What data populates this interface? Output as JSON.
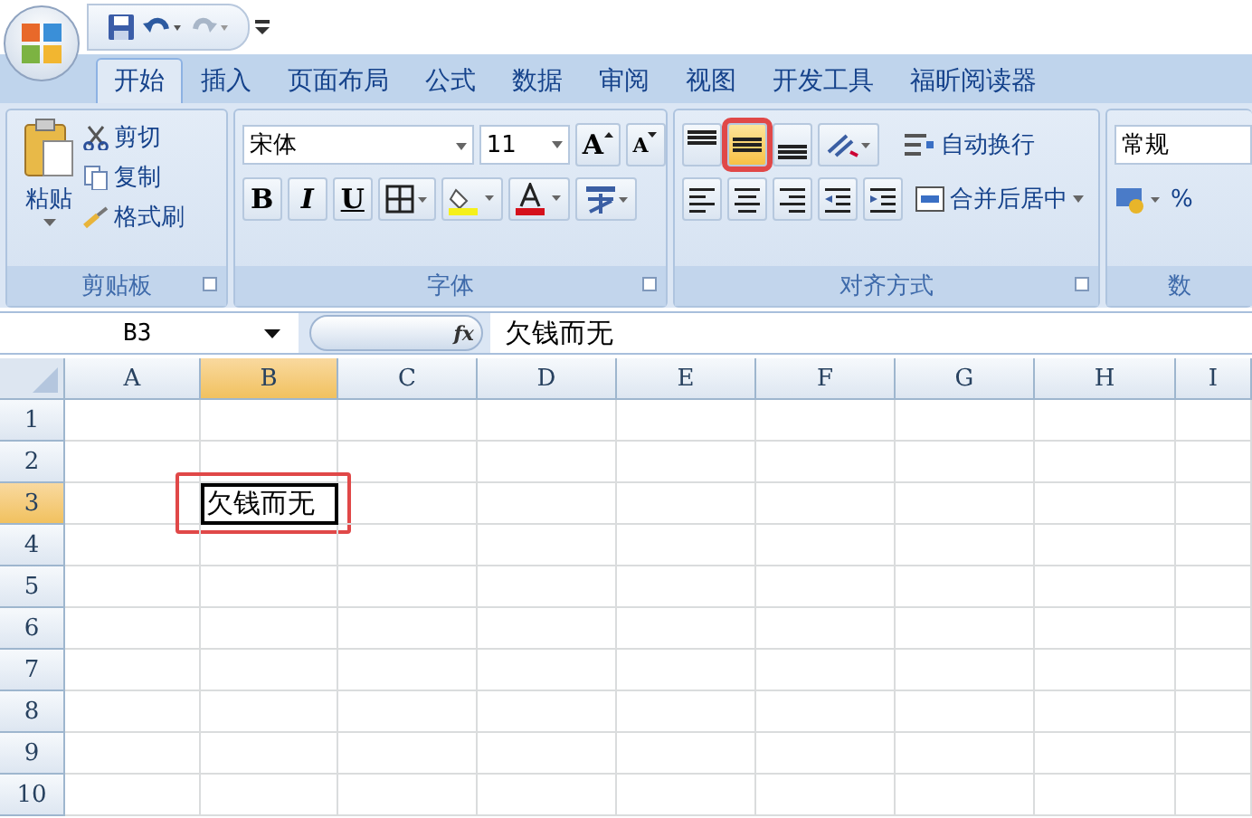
{
  "tabs": [
    {
      "label": "开始",
      "selected": true
    },
    {
      "label": "插入",
      "selected": false
    },
    {
      "label": "页面布局",
      "selected": false
    },
    {
      "label": "公式",
      "selected": false
    },
    {
      "label": "数据",
      "selected": false
    },
    {
      "label": "审阅",
      "selected": false
    },
    {
      "label": "视图",
      "selected": false
    },
    {
      "label": "开发工具",
      "selected": false
    },
    {
      "label": "福昕阅读器",
      "selected": false
    }
  ],
  "clipboard": {
    "title": "剪贴板",
    "paste": "粘贴",
    "items": [
      {
        "kind": "cut",
        "label": "剪切"
      },
      {
        "kind": "copy",
        "label": "复制"
      },
      {
        "kind": "brush",
        "label": "格式刷"
      }
    ]
  },
  "font": {
    "title": "字体",
    "font_name": "宋体",
    "font_size": "11",
    "grow": "A",
    "shrink": "A",
    "bold": "B",
    "italic": "I",
    "underline": "U"
  },
  "alignment": {
    "title": "对齐方式",
    "vertical": [
      {
        "kind": "top",
        "selected": false,
        "highlighted": false
      },
      {
        "kind": "middle",
        "selected": true,
        "highlighted": true
      },
      {
        "kind": "bottom",
        "selected": false,
        "highlighted": false
      }
    ],
    "horizontal": [
      {
        "kind": "left",
        "selected": false
      },
      {
        "kind": "center",
        "selected": false
      },
      {
        "kind": "right",
        "selected": false
      }
    ],
    "wrap_text": "自动换行",
    "merge_center": "合并后居中"
  },
  "number": {
    "title": "数",
    "format": "常规",
    "percent": "%"
  },
  "formula_bar": {
    "name_box": "B3",
    "fx": "fx",
    "content": "欠钱而无"
  },
  "columns": [
    {
      "label": "A",
      "selected": false
    },
    {
      "label": "B",
      "selected": true
    },
    {
      "label": "C",
      "selected": false
    },
    {
      "label": "D",
      "selected": false
    },
    {
      "label": "E",
      "selected": false
    },
    {
      "label": "F",
      "selected": false
    },
    {
      "label": "G",
      "selected": false
    },
    {
      "label": "H",
      "selected": false
    },
    {
      "label": "I",
      "selected": false
    }
  ],
  "rows": [
    {
      "label": "1",
      "selected": false,
      "cells": [
        {
          "active": false
        },
        {
          "active": false
        },
        {
          "active": false
        },
        {
          "active": false
        },
        {
          "active": false
        },
        {
          "active": false
        },
        {
          "active": false
        },
        {
          "active": false
        },
        {
          "active": false
        }
      ]
    },
    {
      "label": "2",
      "selected": false,
      "cells": [
        {
          "active": false
        },
        {
          "active": false
        },
        {
          "active": false
        },
        {
          "active": false
        },
        {
          "active": false
        },
        {
          "active": false
        },
        {
          "active": false
        },
        {
          "active": false
        },
        {
          "active": false
        }
      ]
    },
    {
      "label": "3",
      "selected": true,
      "cells": [
        {
          "active": false
        },
        {
          "value": "欠钱而无",
          "active": true,
          "highlighted": true
        },
        {
          "active": false
        },
        {
          "active": false
        },
        {
          "active": false
        },
        {
          "active": false
        },
        {
          "active": false
        },
        {
          "active": false
        },
        {
          "active": false
        }
      ]
    },
    {
      "label": "4",
      "selected": false,
      "cells": [
        {
          "active": false
        },
        {
          "active": false
        },
        {
          "active": false
        },
        {
          "active": false
        },
        {
          "active": false
        },
        {
          "active": false
        },
        {
          "active": false
        },
        {
          "active": false
        },
        {
          "active": false
        }
      ]
    },
    {
      "label": "5",
      "selected": false,
      "cells": [
        {
          "active": false
        },
        {
          "active": false
        },
        {
          "active": false
        },
        {
          "active": false
        },
        {
          "active": false
        },
        {
          "active": false
        },
        {
          "active": false
        },
        {
          "active": false
        },
        {
          "active": false
        }
      ]
    },
    {
      "label": "6",
      "selected": false,
      "cells": [
        {
          "active": false
        },
        {
          "active": false
        },
        {
          "active": false
        },
        {
          "active": false
        },
        {
          "active": false
        },
        {
          "active": false
        },
        {
          "active": false
        },
        {
          "active": false
        },
        {
          "active": false
        }
      ]
    },
    {
      "label": "7",
      "selected": false,
      "cells": [
        {
          "active": false
        },
        {
          "active": false
        },
        {
          "active": false
        },
        {
          "active": false
        },
        {
          "active": false
        },
        {
          "active": false
        },
        {
          "active": false
        },
        {
          "active": false
        },
        {
          "active": false
        }
      ]
    },
    {
      "label": "8",
      "selected": false,
      "cells": [
        {
          "active": false
        },
        {
          "active": false
        },
        {
          "active": false
        },
        {
          "active": false
        },
        {
          "active": false
        },
        {
          "active": false
        },
        {
          "active": false
        },
        {
          "active": false
        },
        {
          "active": false
        }
      ]
    },
    {
      "label": "9",
      "selected": false,
      "cells": [
        {
          "active": false
        },
        {
          "active": false
        },
        {
          "active": false
        },
        {
          "active": false
        },
        {
          "active": false
        },
        {
          "active": false
        },
        {
          "active": false
        },
        {
          "active": false
        },
        {
          "active": false
        }
      ]
    },
    {
      "label": "10",
      "selected": false,
      "cells": [
        {
          "active": false
        },
        {
          "active": false
        },
        {
          "active": false
        },
        {
          "active": false
        },
        {
          "active": false
        },
        {
          "active": false
        },
        {
          "active": false
        },
        {
          "active": false
        },
        {
          "active": false
        }
      ]
    }
  ]
}
